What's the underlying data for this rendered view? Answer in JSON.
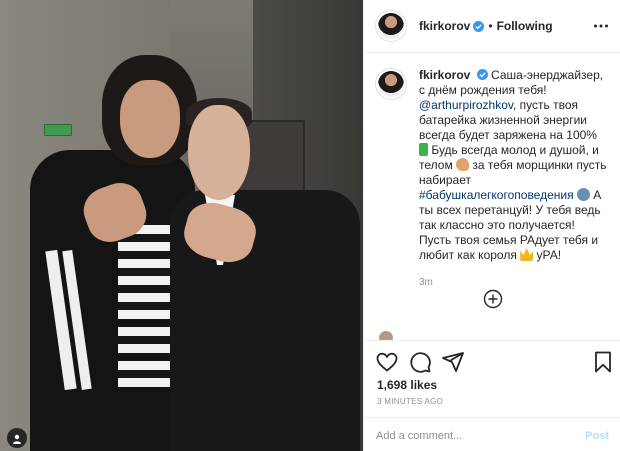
{
  "post": {
    "username": "fkirkorov",
    "follow_state": "Following",
    "separator": "•"
  },
  "caption": {
    "username": "fkirkorov",
    "text_1": "Саша-энерджайзер, с днём рождения тебя!",
    "mention": "@arthurpirozhkov",
    "text_2": ", пусть твоя батарейка жизненной энергии всегда будет заряжена на 100%",
    "text_3": "Будь всегда молод и душой, и телом",
    "text_4": "за тебя морщинки пусть набирает",
    "hashtag": "#бабушкалегкогоповедения",
    "text_5": "А ты всех перетанцуй! У тебя ведь так классно это получается! Пусть твоя семья РАдует тебя и любит как короля",
    "text_6": "уРА!",
    "time": "3m",
    "emoji": [
      "battery",
      "muscle",
      "dancer",
      "crown"
    ]
  },
  "stats": {
    "likes": "1,698 likes",
    "time_ago": "3 MINUTES AGO"
  },
  "comment": {
    "placeholder": "Add a comment...",
    "post_label": "Post"
  },
  "icons": {
    "more": "more-icon",
    "heart": "heart-icon",
    "comment": "comment-icon",
    "share": "share-icon",
    "save": "bookmark-icon",
    "add": "plus-circle-icon",
    "verified": "verified-badge-icon",
    "user_tag": "user-tag-icon"
  },
  "colors": {
    "link": "#00376b",
    "verified": "#3897f0",
    "muted": "#8e8e8e",
    "post_disabled": "#b2dffc"
  }
}
